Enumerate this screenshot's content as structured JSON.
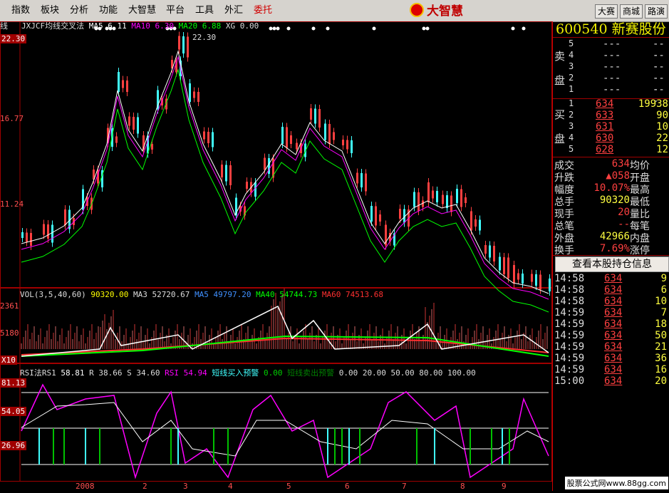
{
  "menu": {
    "items": [
      "指数",
      "板块",
      "分析",
      "功能",
      "大智慧",
      "平台",
      "工具",
      "外汇",
      "委托"
    ],
    "active_index": 8,
    "brand": "大智慧",
    "right_buttons": [
      "大赛",
      "商城",
      "路演"
    ]
  },
  "chart": {
    "price_header": {
      "name": "JXJCF均线交叉法",
      "ma5": "MA5 6.11",
      "ma10": "MA10 6.30",
      "ma20": "MA20 6.88",
      "xg": "XG 0.00"
    },
    "price_axis": [
      "22.30",
      "16.77",
      "11.24"
    ],
    "price_axis_prefix": "线",
    "high_marker": "22.30",
    "vol_header": {
      "name": "VOL(3,5,40,60)",
      "vol": "90320.00",
      "ma3": "MA3 52720.67",
      "ma5": "MA5 49797.20",
      "ma40": "MA40 54744.73",
      "ma60": "MA60 74513.68"
    },
    "vol_axis": [
      "2361",
      "5180",
      "X10"
    ],
    "rsi_header": {
      "name": "RSI法RS1",
      "rs1": "58.81",
      "r": "R 38.66",
      "s": "S 34.60",
      "rsi": "RSI 54.94",
      "buy": "短线买入预警",
      "buy_val": "0.00",
      "sell": "短线卖出预警",
      "sell_tail": "0.00   20.00   50.00   80.00   100.00"
    },
    "rsi_axis": [
      "81.13",
      "54.05",
      "26.96"
    ],
    "x_labels": [
      "2008",
      "2",
      "3",
      "4",
      "5",
      "6",
      "7",
      "8",
      "9"
    ],
    "colors": {
      "up": "#ff4040",
      "down": "#40ffff",
      "ma5": "#ffffff",
      "ma10": "#ffff00",
      "ma20": "#ff00ff",
      "ma_long": "#00ff00",
      "ma60": "#ff3030",
      "rsi": "#ff00ff",
      "grid": "#a00000"
    }
  },
  "quote": {
    "code": "600540",
    "name": "新赛股份",
    "sell_label": [
      "卖",
      "盘"
    ],
    "buy_label": [
      "买",
      "盘"
    ],
    "asks": [
      [
        "5",
        "---",
        "---"
      ],
      [
        "4",
        "---",
        "---"
      ],
      [
        "3",
        "---",
        "---"
      ],
      [
        "2",
        "---",
        "---"
      ],
      [
        "1",
        "---",
        "---"
      ]
    ],
    "bids": [
      [
        "1",
        "634",
        "19938"
      ],
      [
        "2",
        "633",
        "90"
      ],
      [
        "3",
        "631",
        "10"
      ],
      [
        "4",
        "630",
        "22"
      ],
      [
        "5",
        "628",
        "12"
      ]
    ],
    "stats": [
      [
        "成交",
        "634",
        "均价",
        ""
      ],
      [
        "升跌",
        "▲058",
        "开盘",
        ""
      ],
      [
        "幅度",
        "10.07%",
        "最高",
        ""
      ],
      [
        "总手",
        "90320",
        "最低",
        ""
      ],
      [
        "现手",
        "20",
        "量比",
        ""
      ],
      [
        "总笔",
        "--",
        "每笔",
        ""
      ],
      [
        "外盘",
        "42966",
        "内盘",
        ""
      ],
      [
        "换手",
        "7.69%",
        "涨停",
        ""
      ]
    ],
    "hold_button": "查看本股持仓信息",
    "ticks": [
      [
        "14:58",
        "634",
        "9"
      ],
      [
        "14:58",
        "634",
        "6"
      ],
      [
        "14:58",
        "634",
        "10"
      ],
      [
        "14:59",
        "634",
        "7"
      ],
      [
        "14:59",
        "634",
        "18"
      ],
      [
        "14:59",
        "634",
        "50"
      ],
      [
        "14:59",
        "634",
        "21"
      ],
      [
        "14:59",
        "634",
        "36"
      ],
      [
        "14:59",
        "634",
        "16"
      ],
      [
        "15:00",
        "634",
        "20"
      ]
    ]
  },
  "footer": "股票公式网www.88gg.com"
}
